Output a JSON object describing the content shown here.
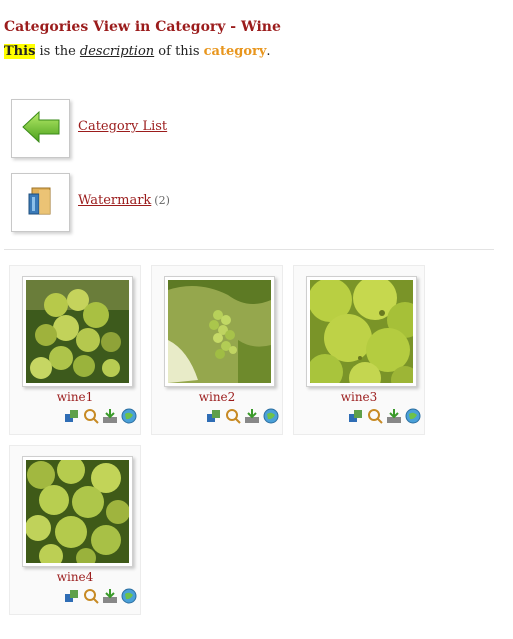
{
  "page": {
    "title": "Categories View in Category - Wine",
    "description": {
      "highlight": "This",
      "text1": " is the ",
      "emph": "description",
      "text2": " of this ",
      "category_word": "category",
      "end": "."
    }
  },
  "categories": [
    {
      "label": "Category List",
      "icon": "back-arrow-icon",
      "count": ""
    },
    {
      "label": "Watermark",
      "icon": "folder-icon",
      "count": "(2)"
    }
  ],
  "images": [
    {
      "name": "wine1",
      "icon": "grapes-photo"
    },
    {
      "name": "wine2",
      "icon": "grapes-photo"
    },
    {
      "name": "wine3",
      "icon": "grapes-photo"
    },
    {
      "name": "wine4",
      "icon": "grapes-photo"
    }
  ],
  "image_actions": [
    "info-icon",
    "zoom-icon",
    "download-icon",
    "globe-icon"
  ],
  "colors": {
    "title": "#9b1c1c",
    "category_highlight": "#e8961e",
    "highlight_bg": "#ffff00"
  }
}
